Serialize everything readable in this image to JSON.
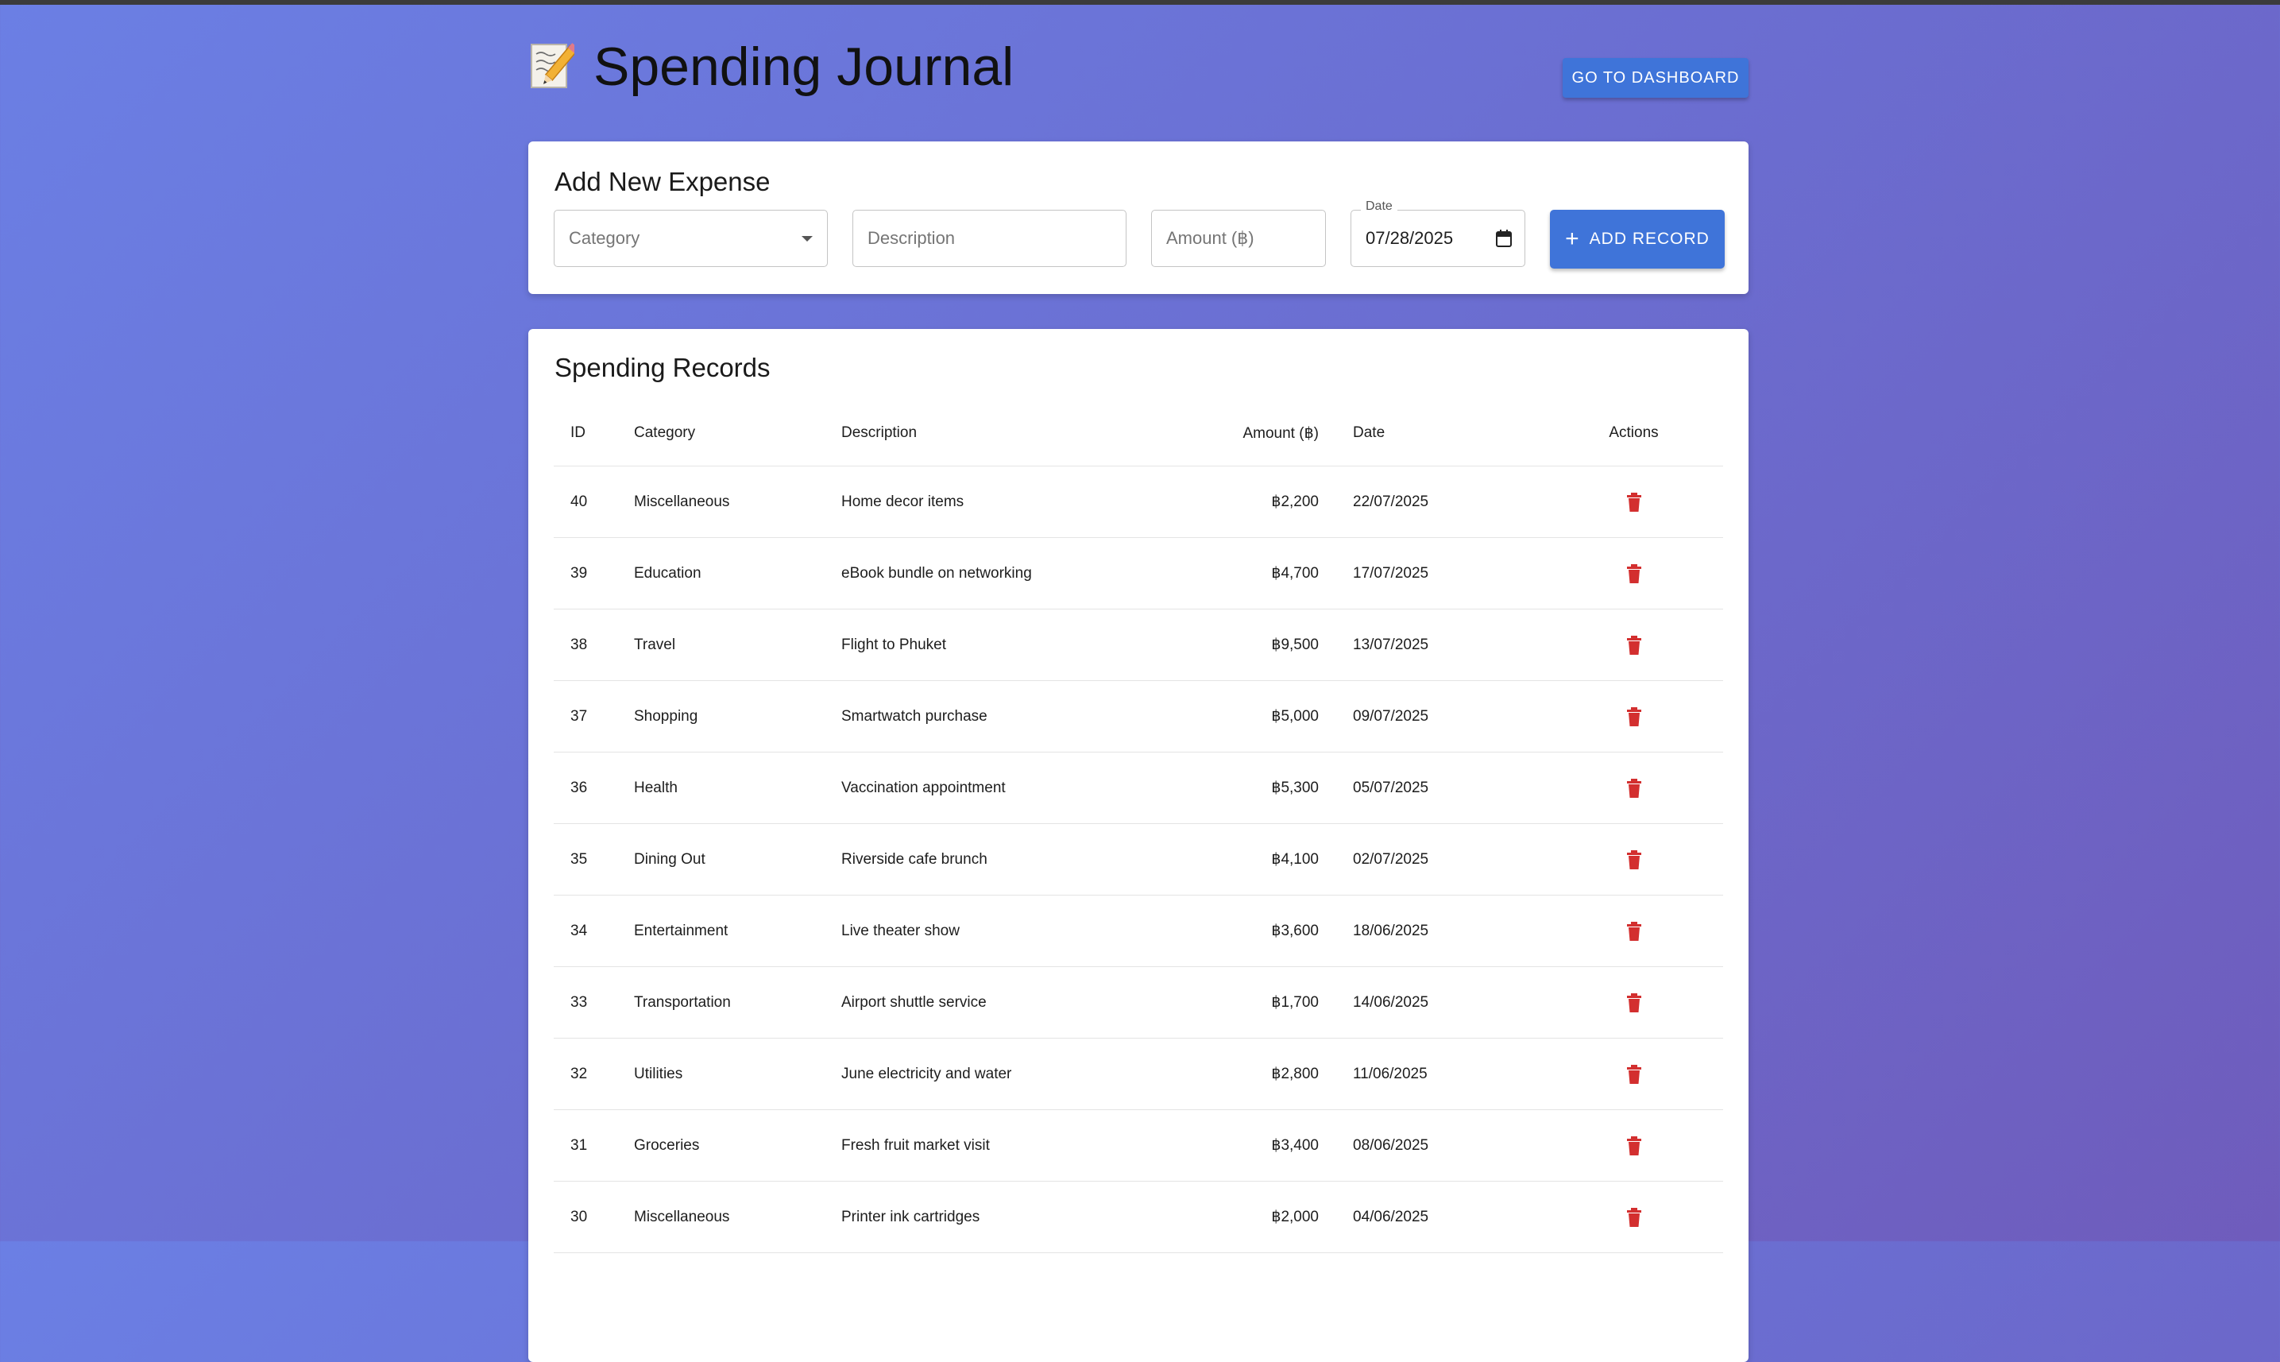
{
  "header": {
    "title": "Spending Journal",
    "title_icon": "memo-pencil-icon",
    "dashboard_button": "GO TO DASHBOARD"
  },
  "add_expense": {
    "title": "Add New Expense",
    "category_placeholder": "Category",
    "description_placeholder": "Description",
    "amount_placeholder": "Amount (฿)",
    "date_label": "Date",
    "date_value": "07/28/2025",
    "add_button": "ADD RECORD"
  },
  "records": {
    "title": "Spending Records",
    "columns": [
      "ID",
      "Category",
      "Description",
      "Amount (฿)",
      "Date",
      "Actions"
    ],
    "rows": [
      {
        "id": "40",
        "category": "Miscellaneous",
        "description": "Home decor items",
        "amount": "฿2,200",
        "date": "22/07/2025"
      },
      {
        "id": "39",
        "category": "Education",
        "description": "eBook bundle on networking",
        "amount": "฿4,700",
        "date": "17/07/2025"
      },
      {
        "id": "38",
        "category": "Travel",
        "description": "Flight to Phuket",
        "amount": "฿9,500",
        "date": "13/07/2025"
      },
      {
        "id": "37",
        "category": "Shopping",
        "description": "Smartwatch purchase",
        "amount": "฿5,000",
        "date": "09/07/2025"
      },
      {
        "id": "36",
        "category": "Health",
        "description": "Vaccination appointment",
        "amount": "฿5,300",
        "date": "05/07/2025"
      },
      {
        "id": "35",
        "category": "Dining Out",
        "description": "Riverside cafe brunch",
        "amount": "฿4,100",
        "date": "02/07/2025"
      },
      {
        "id": "34",
        "category": "Entertainment",
        "description": "Live theater show",
        "amount": "฿3,600",
        "date": "18/06/2025"
      },
      {
        "id": "33",
        "category": "Transportation",
        "description": "Airport shuttle service",
        "amount": "฿1,700",
        "date": "14/06/2025"
      },
      {
        "id": "32",
        "category": "Utilities",
        "description": "June electricity and water",
        "amount": "฿2,800",
        "date": "11/06/2025"
      },
      {
        "id": "31",
        "category": "Groceries",
        "description": "Fresh fruit market visit",
        "amount": "฿3,400",
        "date": "08/06/2025"
      },
      {
        "id": "30",
        "category": "Miscellaneous",
        "description": "Printer ink cartridges",
        "amount": "฿2,000",
        "date": "04/06/2025"
      }
    ],
    "delete_icon": "trash-icon",
    "delete_color": "#d32f2f"
  },
  "colors": {
    "primary": "#3f74d9",
    "background_start": "#6b7fe4",
    "background_end": "#6f5cbc"
  }
}
